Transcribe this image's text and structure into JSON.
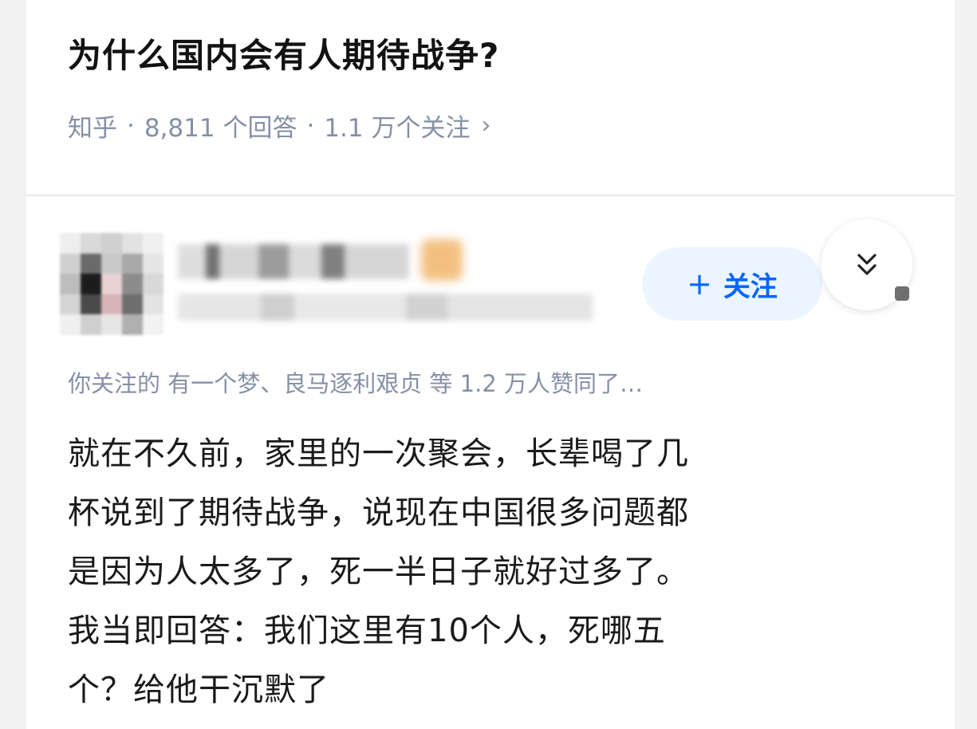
{
  "question": {
    "title": "为什么国内会有人期待战争?",
    "meta": {
      "source": "知乎",
      "separator": "·",
      "answers": "8,811 个回答",
      "followers": "1.1 万个关注",
      "chevron": "›"
    }
  },
  "answer": {
    "author": {
      "avatar_icon": "avatar-pixelated",
      "name": "",
      "badge_icon": "badge-icon",
      "bio": ""
    },
    "follow_button": {
      "icon": "+",
      "label": "关注"
    },
    "expand_button": {
      "icon": "double-chevron-down-icon",
      "glyph": "≫"
    },
    "social_proof": "你关注的 有一个梦、良马逐利艰贞 等 1.2 万人赞同了…",
    "content_lines": [
      "就在不久前，家里的一次聚会，长辈喝了几",
      "杯说到了期待战争，说现在中国很多问题都",
      "是因为人太多了，死一半日子就好过多了。",
      "我当即回答：我们这里有10个人，死哪五",
      "个？给他干沉默了"
    ]
  },
  "colors": {
    "title": "#121212",
    "meta": "#8590a6",
    "accent": "#0066ff",
    "accent_bg": "#ebf5ff",
    "body_text": "#1a1a1a",
    "divider": "#e6e6e6"
  }
}
